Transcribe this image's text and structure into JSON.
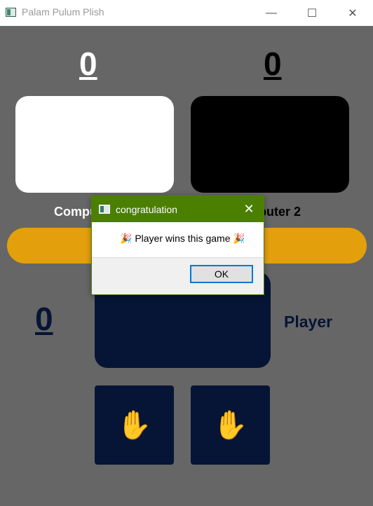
{
  "window": {
    "title": "Palam Pulum Plish",
    "minimize_glyph": "—",
    "maximize_glyph": "☐",
    "close_glyph": "✕"
  },
  "scores": {
    "computer1": "0",
    "computer2": "0",
    "player": "0"
  },
  "labels": {
    "computer1": "Computer 1",
    "computer2": "Computer 2",
    "player": "Player"
  },
  "cards": {
    "computer1_color": "#ffffff",
    "computer2_color": "#000000",
    "player_color": "#061535"
  },
  "hands": {
    "left_icon": "raised-hand-icon",
    "right_icon": "raised-hand-icon",
    "glyph": "✋"
  },
  "dialog": {
    "title": "congratulation",
    "message": "🎉 Player wins this game 🎉",
    "ok_label": "OK",
    "close_glyph": "✕"
  },
  "colors": {
    "background": "#666666",
    "bar": "#e4a00c",
    "dialog_title": "#4a7f00",
    "player_card": "#061535"
  }
}
